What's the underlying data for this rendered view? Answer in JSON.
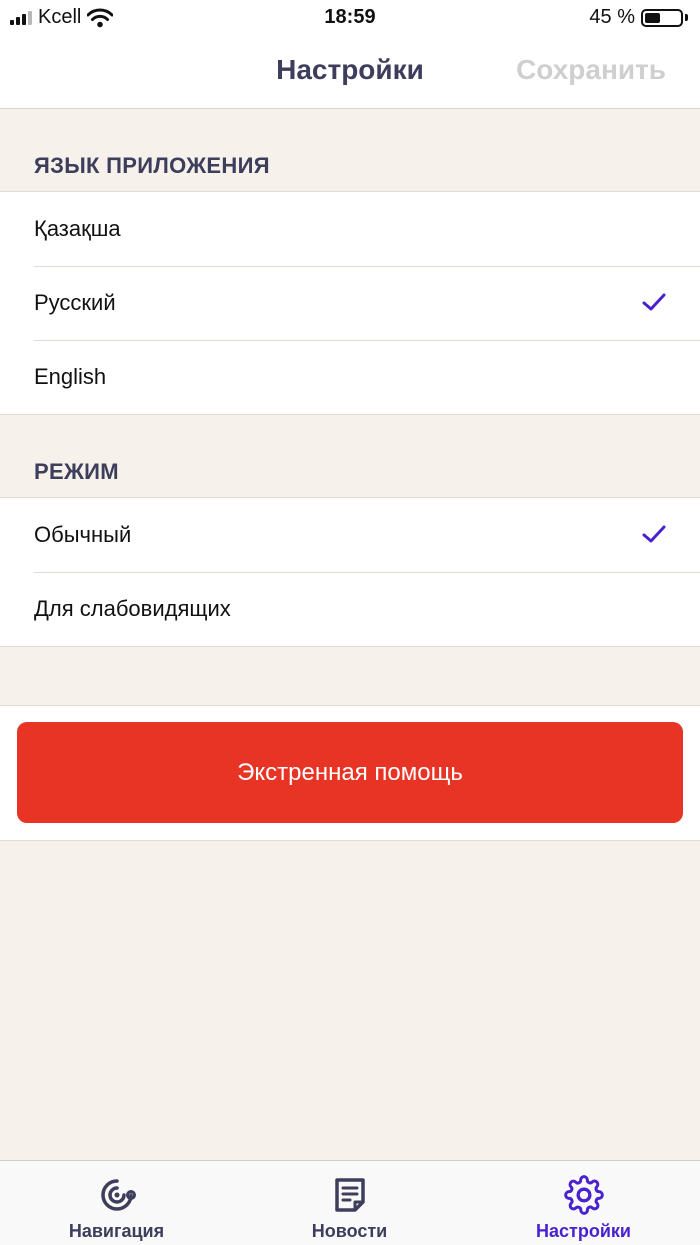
{
  "status_bar": {
    "carrier": "Kcell",
    "time": "18:59",
    "battery_text": "45 %",
    "battery_level": 0.45
  },
  "nav": {
    "title": "Настройки",
    "save_label": "Сохранить"
  },
  "language_section": {
    "header": "ЯЗЫК ПРИЛОЖЕНИЯ",
    "items": [
      {
        "label": "Қазақша",
        "selected": false
      },
      {
        "label": "Русский",
        "selected": true
      },
      {
        "label": "English",
        "selected": false
      }
    ]
  },
  "mode_section": {
    "header": "РЕЖИМ",
    "items": [
      {
        "label": "Обычный",
        "selected": true
      },
      {
        "label": "Для слабовидящих",
        "selected": false
      }
    ]
  },
  "emergency": {
    "label": "Экстренная помощь",
    "color": "#e83424"
  },
  "tabs": [
    {
      "label": "Навигация",
      "icon": "navigation-icon",
      "active": false
    },
    {
      "label": "Новости",
      "icon": "news-icon",
      "active": false
    },
    {
      "label": "Настройки",
      "icon": "gear-icon",
      "active": true
    }
  ],
  "colors": {
    "accent": "#4a21d1",
    "background": "#f6f1eb",
    "emergency": "#e83424"
  }
}
